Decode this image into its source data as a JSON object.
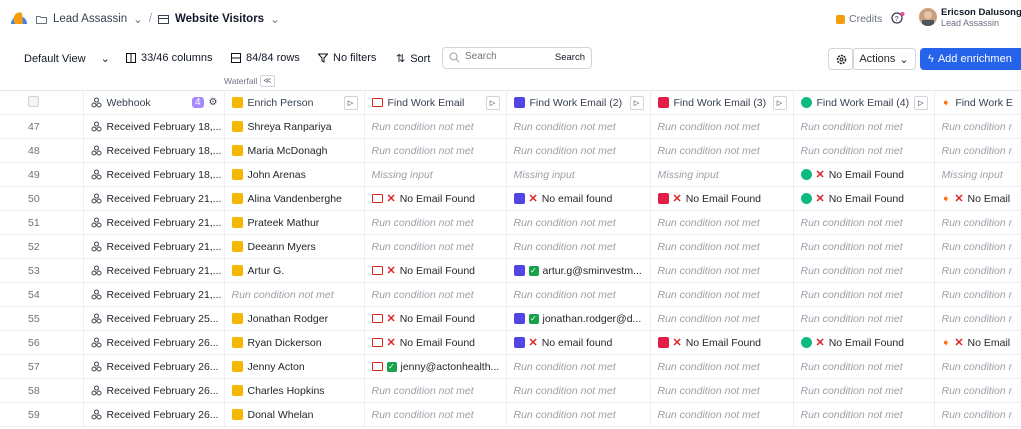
{
  "breadcrumb": {
    "workspace": "Lead Assassin",
    "table": "Website Visitors"
  },
  "header": {
    "credits": "Credits",
    "user_name": "Ericson Dalusong",
    "user_org": "Lead Assassin"
  },
  "toolbar": {
    "view": "Default View",
    "columns": "33/46 columns",
    "rows": "84/84 rows",
    "filters": "No filters",
    "sort": "Sort",
    "search_placeholder": "Search",
    "search_button": "Search",
    "actions": "Actions",
    "add_enrichment": "Add enrichmen",
    "waterfall": "Waterfall",
    "waterfall_btn": "≪"
  },
  "columns": {
    "webhook": "Webhook",
    "webhook_badge": "4",
    "enrich_person": "Enrich Person",
    "find1": "Find Work Email",
    "find2": "Find Work Email (2)",
    "find3": "Find Work Email (3)",
    "find4": "Find Work Email (4)",
    "find5": "Find Work E"
  },
  "rows": [
    {
      "n": "47",
      "webhook": "Received February 18,...",
      "person": "Shreya Ranpariya",
      "c1": "Run condition not met",
      "c2": "Run condition not met",
      "c3": "Run condition not met",
      "c4": "Run condition not met",
      "c5": "Run condition r"
    },
    {
      "n": "48",
      "webhook": "Received February 18,...",
      "person": "Maria McDonagh",
      "c1": "Run condition not met",
      "c2": "Run condition not met",
      "c3": "Run condition not met",
      "c4": "Run condition not met",
      "c5": "Run condition r"
    },
    {
      "n": "49",
      "webhook": "Received February 18,...",
      "person": "John Arenas",
      "c1": "Missing input",
      "c2": "Missing input",
      "c3": "Missing input",
      "c4": "No Email Found",
      "c5": "Missing input"
    },
    {
      "n": "50",
      "webhook": "Received February 21,...",
      "person": "Alina Vandenberghe",
      "c1": "No Email Found",
      "c2": "No email found",
      "c3": "No Email Found",
      "c4": "No Email Found",
      "c5": "No Email"
    },
    {
      "n": "51",
      "webhook": "Received February 21,...",
      "person": "Prateek Mathur",
      "c1": "Run condition not met",
      "c2": "Run condition not met",
      "c3": "Run condition not met",
      "c4": "Run condition not met",
      "c5": "Run condition r"
    },
    {
      "n": "52",
      "webhook": "Received February 21,...",
      "person": "Deeann Myers",
      "c1": "Run condition not met",
      "c2": "Run condition not met",
      "c3": "Run condition not met",
      "c4": "Run condition not met",
      "c5": "Run condition r"
    },
    {
      "n": "53",
      "webhook": "Received February 21,...",
      "person": "Artur G.",
      "c1": "No Email Found",
      "c2": "artur.g@sminvestm...",
      "c3": "Run condition not met",
      "c4": "Run condition not met",
      "c5": "Run condition r"
    },
    {
      "n": "54",
      "webhook": "Received February 21,...",
      "person": "Run condition not met",
      "c1": "Run condition not met",
      "c2": "Run condition not met",
      "c3": "Run condition not met",
      "c4": "Run condition not met",
      "c5": "Run condition r"
    },
    {
      "n": "55",
      "webhook": "Received February 25...",
      "person": "Jonathan Rodger",
      "c1": "No Email Found",
      "c2": "jonathan.rodger@d...",
      "c3": "Run condition not met",
      "c4": "Run condition not met",
      "c5": "Run condition r"
    },
    {
      "n": "56",
      "webhook": "Received February 26...",
      "person": "Ryan Dickerson",
      "c1": "No Email Found",
      "c2": "No email found",
      "c3": "No Email Found",
      "c4": "No Email Found",
      "c5": "No Email"
    },
    {
      "n": "57",
      "webhook": "Received February 26...",
      "person": "Jenny Acton",
      "c1": "jenny@actonhealth...",
      "c2": "Run condition not met",
      "c3": "Run condition not met",
      "c4": "Run condition not met",
      "c5": "Run condition r"
    },
    {
      "n": "58",
      "webhook": "Received February 26...",
      "person": "Charles Hopkins",
      "c1": "Run condition not met",
      "c2": "Run condition not met",
      "c3": "Run condition not met",
      "c4": "Run condition not met",
      "c5": "Run condition r"
    },
    {
      "n": "59",
      "webhook": "Received February 26...",
      "person": "Donal Whelan",
      "c1": "Run condition not met",
      "c2": "Run condition not met",
      "c3": "Run condition not met",
      "c4": "Run condition not met",
      "c5": "Run condition r"
    }
  ]
}
